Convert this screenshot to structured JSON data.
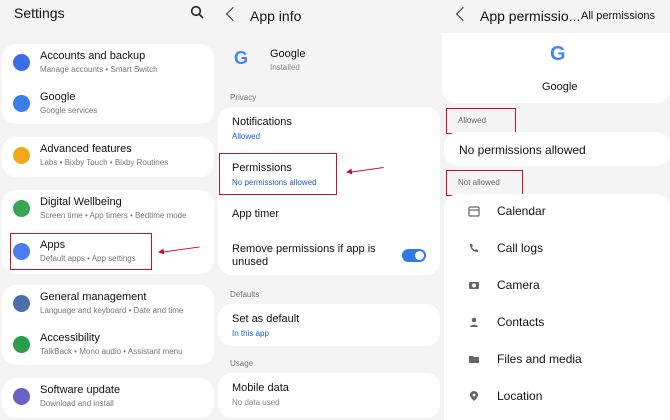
{
  "settings": {
    "title": "Settings",
    "items": [
      {
        "title": "Accounts and backup",
        "subtitle": "Manage accounts  •  Smart Switch",
        "color": "#3b6de6"
      },
      {
        "title": "Google",
        "subtitle": "Google services",
        "color": "#3b7de9"
      },
      {
        "title": "Advanced features",
        "subtitle": "Labs  •  Bixby Touch  •  Bixby Routines",
        "color": "#f1a81c"
      },
      {
        "title": "Digital Wellbeing",
        "subtitle": "Screen time  •  App timers  •  Bedtime mode",
        "color": "#37a653"
      },
      {
        "title": "Apps",
        "subtitle": "Default apps  •  App settings",
        "color": "#4d7cf0"
      },
      {
        "title": "General management",
        "subtitle": "Language and keyboard  •  Date and time",
        "color": "#4a6ea8"
      },
      {
        "title": "Accessibility",
        "subtitle": "TalkBack  •  Mono audio  •  Assistant menu",
        "color": "#2e9c4f"
      },
      {
        "title": "Software update",
        "subtitle": "Download and install",
        "color": "#6b62c7"
      }
    ]
  },
  "app_info": {
    "title": "App info",
    "app_name": "Google",
    "app_status": "Installed",
    "sections": {
      "privacy": "Privacy",
      "defaults": "Defaults",
      "usage": "Usage"
    },
    "notifications": {
      "title": "Notifications",
      "value": "Allowed"
    },
    "permissions": {
      "title": "Permissions",
      "value": "No permissions allowed"
    },
    "app_timer": "App timer",
    "remove_permissions": "Remove permissions if app is unused",
    "remove_permissions_enabled": true,
    "set_as_default": {
      "title": "Set as default",
      "value": "In this app"
    },
    "mobile_data": {
      "title": "Mobile data",
      "value": "No data used"
    }
  },
  "app_permissions": {
    "title": "App permissio...",
    "all_permissions": "All permissions",
    "app_name": "Google",
    "allowed_header": "Allowed",
    "no_allowed": "No permissions allowed",
    "not_allowed_header": "Not allowed",
    "not_allowed_items": [
      {
        "label": "Calendar",
        "icon": "calendar-icon"
      },
      {
        "label": "Call logs",
        "icon": "call-logs-icon"
      },
      {
        "label": "Camera",
        "icon": "camera-icon"
      },
      {
        "label": "Contacts",
        "icon": "contacts-icon"
      },
      {
        "label": "Files and media",
        "icon": "folder-icon"
      },
      {
        "label": "Location",
        "icon": "location-icon"
      }
    ]
  }
}
